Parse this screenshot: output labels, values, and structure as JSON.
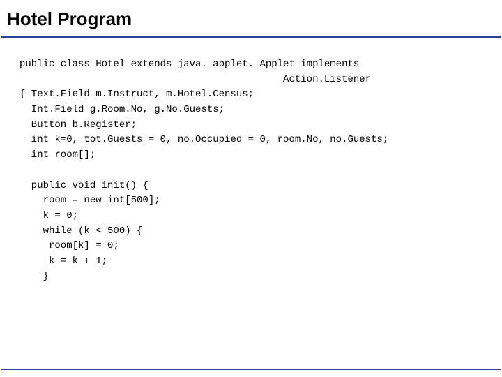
{
  "title": "Hotel Program",
  "code": {
    "l1": "public class Hotel extends java. applet. Applet implements",
    "l2": "                                             Action.Listener",
    "l3": "{ Text.Field m.Instruct, m.Hotel.Census;",
    "l4": "  Int.Field g.Room.No, g.No.Guests;",
    "l5": "  Button b.Register;",
    "l6": "  int k=0, tot.Guests = 0, no.Occupied = 0, room.No, no.Guests;",
    "l7": "  int room[];",
    "l8": "",
    "l9": "  public void init() {",
    "l10": "    room = new int[500];",
    "l11": "    k = 0;",
    "l12": "    while (k < 500) {",
    "l13": "     room[k] = 0;",
    "l14": "     k = k + 1;",
    "l15": "    }"
  }
}
